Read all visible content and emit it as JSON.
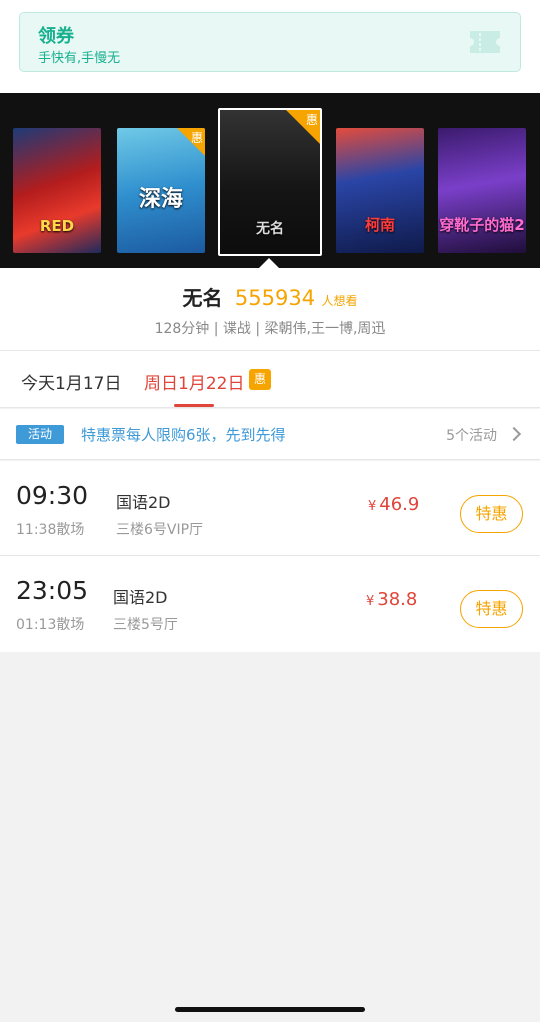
{
  "coupon": {
    "title": "领券",
    "subtitle": "手快有,手慢无",
    "icon": "ticket-icon"
  },
  "posters": [
    {
      "text": "RED",
      "badge": ""
    },
    {
      "text": "深海",
      "badge": "惠"
    },
    {
      "text": "无名",
      "badge": "惠"
    },
    {
      "text": "柯南",
      "badge": ""
    },
    {
      "text": "穿靴子的猫2",
      "badge": ""
    }
  ],
  "movie": {
    "name": "无名",
    "want_count": "555934",
    "want_unit": "人想看",
    "meta": "128分钟 | 谍战 | 梁朝伟,王一博,周迅"
  },
  "dates": {
    "today": "今天1月17日",
    "sunday": "周日1月22日",
    "badge": "惠"
  },
  "promo": {
    "tag": "活动",
    "text": "特惠票每人限购6张，先到先得",
    "count": "5个活动"
  },
  "showtimes": [
    {
      "time": "09:30",
      "end": "11:38散场",
      "lang": "国语2D",
      "hall": "三楼6号VIP厅",
      "currency": "¥",
      "price": "46.9",
      "button": "特惠"
    },
    {
      "time": "23:05",
      "end": "01:13散场",
      "lang": "国语2D",
      "hall": "三楼5号厅",
      "currency": "¥",
      "price": "38.8",
      "button": "特惠"
    }
  ],
  "colors": {
    "accent": "#e0453a",
    "orange": "#f5a400",
    "teal": "#17b08f",
    "blue": "#3f9ad8"
  }
}
